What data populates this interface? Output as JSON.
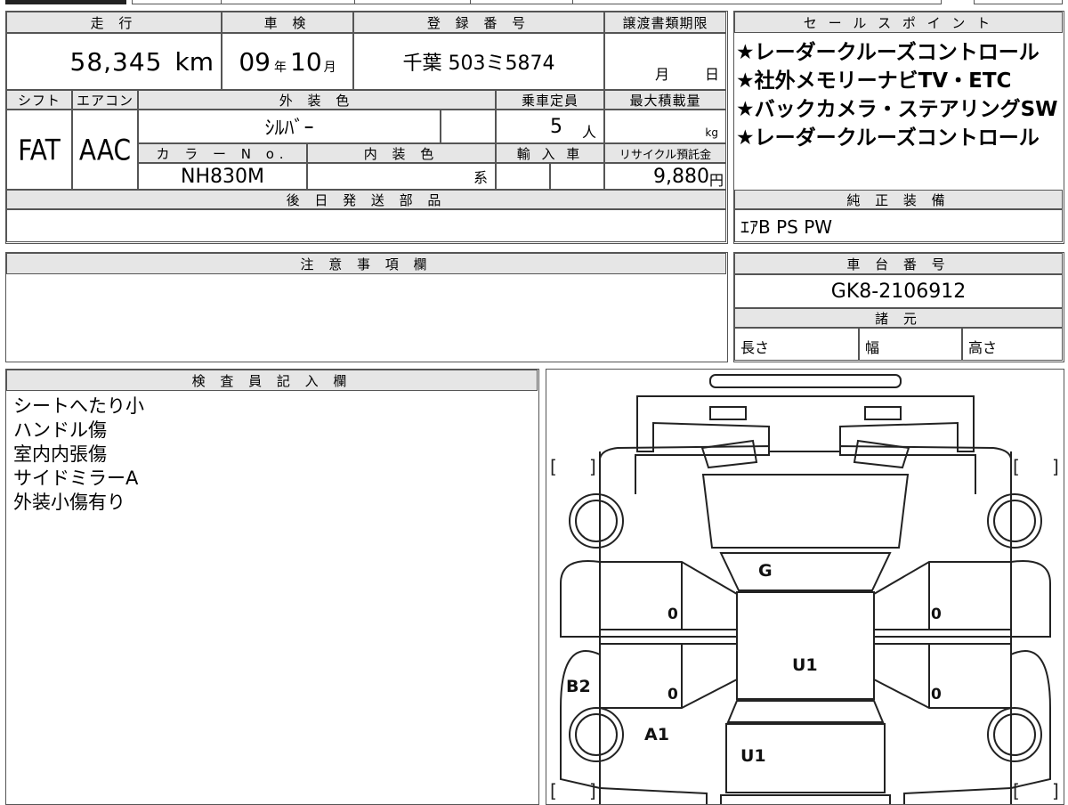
{
  "headers": {
    "mileage": "走 行",
    "inspection": "車 検",
    "registration": "登 録 番 号",
    "transfer_deadline": "譲渡書類期限",
    "sales_points": "セ ー ル ス ポ イ ン ト",
    "shift": "シフト",
    "aircon": "エアコン",
    "exterior_color": "外 装 色",
    "capacity": "乗車定員",
    "max_load": "最大積載量",
    "color_no": "カ ラ ー N o.",
    "interior_color": "内 装 色",
    "import": "輸 入 車",
    "recycle": "リサイクル預託金",
    "later_parts": "後 日 発 送 部 品",
    "genuine_equipment": "純 正 装 備",
    "notes": "注 意 事 項 欄",
    "chassis_no": "車 台 番 号",
    "specs": "諸 元",
    "inspector": "検 査 員 記 入 欄"
  },
  "values": {
    "mileage": "58,345",
    "mileage_unit": "km",
    "inspection_year": "09",
    "year_unit": "年",
    "inspection_month": "10",
    "month_unit": "月",
    "registration": "千葉 503ミ5874",
    "deadline_month_unit": "月",
    "deadline_day_unit": "日",
    "shift": "FAT",
    "aircon": "AAC",
    "exterior_color": "ｼﾙﾊﾞｰ",
    "capacity": "5",
    "capacity_unit": "人",
    "load_unit": "kg",
    "color_no": "NH830M",
    "interior_suffix": "系",
    "recycle": "9,880",
    "recycle_unit": "円",
    "genuine_equipment": "ｴｱB PS PW",
    "chassis_no": "GK8-2106912",
    "length_label": "長さ",
    "width_label": "幅",
    "height_label": "高さ"
  },
  "sales_points": [
    "★レーダークルーズコントロール",
    "★社外メモリーナビTV・ETC",
    "★バックカメラ・ステアリングSW",
    "★レーダークルーズコントロール"
  ],
  "inspector_notes": [
    "シートへたり小",
    "ハンドル傷",
    "室内内張傷",
    "サイドミラーA",
    "外装小傷有り"
  ],
  "diagram_marks": {
    "front_window": "G",
    "left_front_door": "0",
    "right_front_door": "0",
    "left_rear_door": "0",
    "right_rear_door": "0",
    "roof": "U1",
    "rear_panel": "U1",
    "left_rear_fender": "B2",
    "left_rear_wheel": "A1",
    "bracket_open": "[",
    "bracket_close": "]"
  }
}
